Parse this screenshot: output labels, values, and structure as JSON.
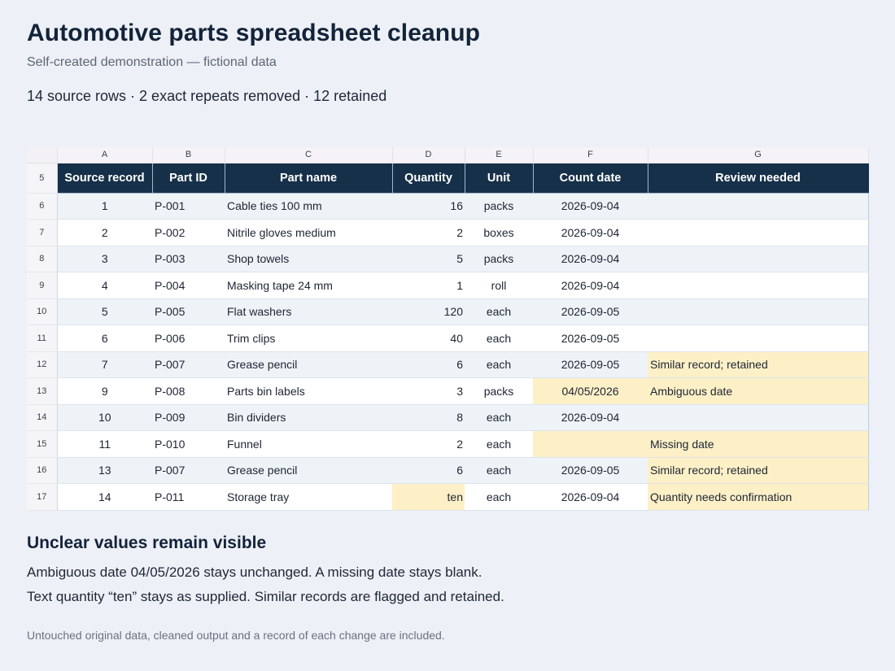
{
  "header": {
    "title": "Automotive parts spreadsheet cleanup",
    "subtitle": "Self-created demonstration — fictional data",
    "summary": "14 source rows · 2 exact repeats removed · 12 retained"
  },
  "sheet": {
    "column_letters": [
      "A",
      "B",
      "C",
      "D",
      "E",
      "F",
      "G"
    ],
    "header_row_number": "5",
    "headers": [
      "Source record",
      "Part ID",
      "Part name",
      "Quantity",
      "Unit",
      "Count date",
      "Review needed"
    ],
    "rows": [
      {
        "n": "6",
        "cells": [
          "1",
          "P-001",
          "Cable ties 100 mm",
          "16",
          "packs",
          "2026-09-04",
          ""
        ],
        "flags": []
      },
      {
        "n": "7",
        "cells": [
          "2",
          "P-002",
          "Nitrile gloves medium",
          "2",
          "boxes",
          "2026-09-04",
          ""
        ],
        "flags": []
      },
      {
        "n": "8",
        "cells": [
          "3",
          "P-003",
          "Shop towels",
          "5",
          "packs",
          "2026-09-04",
          ""
        ],
        "flags": []
      },
      {
        "n": "9",
        "cells": [
          "4",
          "P-004",
          "Masking tape 24 mm",
          "1",
          "roll",
          "2026-09-04",
          ""
        ],
        "flags": []
      },
      {
        "n": "10",
        "cells": [
          "5",
          "P-005",
          "Flat washers",
          "120",
          "each",
          "2026-09-05",
          ""
        ],
        "flags": []
      },
      {
        "n": "11",
        "cells": [
          "6",
          "P-006",
          "Trim clips",
          "40",
          "each",
          "2026-09-05",
          ""
        ],
        "flags": []
      },
      {
        "n": "12",
        "cells": [
          "7",
          "P-007",
          "Grease pencil",
          "6",
          "each",
          "2026-09-05",
          "Similar record; retained"
        ],
        "flags": [
          6
        ]
      },
      {
        "n": "13",
        "cells": [
          "9",
          "P-008",
          "Parts bin labels",
          "3",
          "packs",
          "04/05/2026",
          "Ambiguous date"
        ],
        "flags": [
          5,
          6
        ]
      },
      {
        "n": "14",
        "cells": [
          "10",
          "P-009",
          "Bin dividers",
          "8",
          "each",
          "2026-09-04",
          ""
        ],
        "flags": []
      },
      {
        "n": "15",
        "cells": [
          "11",
          "P-010",
          "Funnel",
          "2",
          "each",
          "",
          "Missing date"
        ],
        "flags": [
          5,
          6
        ]
      },
      {
        "n": "16",
        "cells": [
          "13",
          "P-007",
          "Grease pencil",
          "6",
          "each",
          "2026-09-05",
          "Similar record; retained"
        ],
        "flags": [
          6
        ]
      },
      {
        "n": "17",
        "cells": [
          "14",
          "P-011",
          "Storage tray",
          "ten",
          "each",
          "2026-09-04",
          "Quantity needs confirmation"
        ],
        "flags": [
          3,
          6
        ]
      }
    ]
  },
  "notes": {
    "title": "Unclear values remain visible",
    "line1": "Ambiguous date 04/05/2026 stays unchanged. A missing date stays blank.",
    "line2": "Text quantity “ten” stays as supplied. Similar records are flagged and retained.",
    "footnote": "Untouched original data, cleaned output and a record of each change are included."
  },
  "colors": {
    "header_fill": "#173049",
    "flag_fill": "#fdf0c7",
    "band_fill": "#eef3f8"
  }
}
